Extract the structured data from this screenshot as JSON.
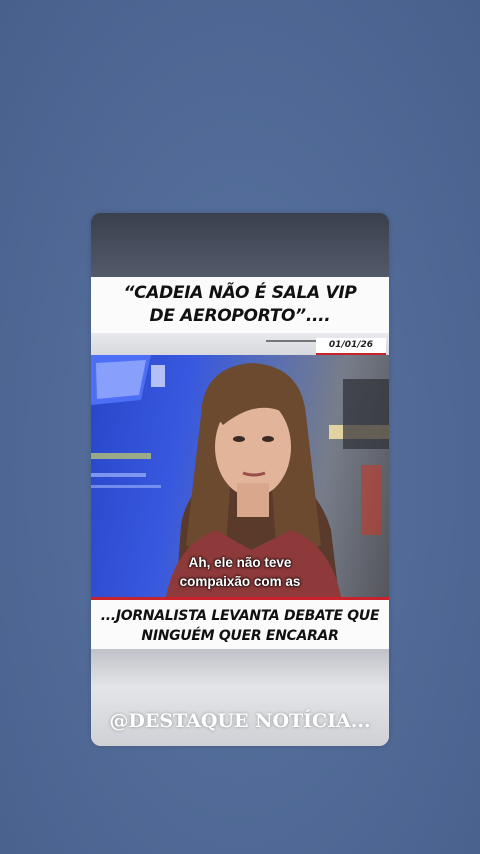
{
  "post": {
    "headline": "“CADEIA NÃO É SALA VIP DE AEROPORTO”....",
    "date": "01/01/26",
    "caption_line1": "Ah, ele não teve",
    "caption_line2": "compaixão com as",
    "subheadline": "...JORNALISTA LEVANTA DEBATE QUE NINGUÉM QUER ENCARAR",
    "watermark": "@DESTAQUE NOTÍCIA..."
  },
  "colors": {
    "background": "#526b98",
    "accent_red": "#c8232c",
    "band_white": "#fbfbfb"
  }
}
